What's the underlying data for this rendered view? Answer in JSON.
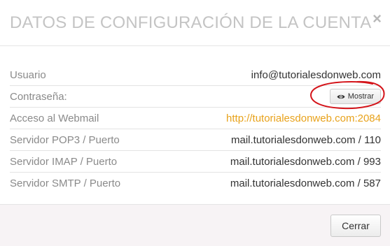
{
  "modal": {
    "title": "DATOS DE CONFIGURACIÓN DE LA CUENTA",
    "close_symbol": "×",
    "close_button_label": "Cerrar"
  },
  "rows": [
    {
      "label": "Usuario",
      "value": "info@tutorialesdonweb.com"
    },
    {
      "label": "Contraseña:",
      "button_label": "Mostrar",
      "button_icon": "eye-icon"
    },
    {
      "label": "Acceso al Webmail",
      "value": "http://tutorialesdonweb.com:2084"
    },
    {
      "label": "Servidor POP3 / Puerto",
      "value": "mail.tutorialesdonweb.com / 110"
    },
    {
      "label": "Servidor IMAP / Puerto",
      "value": "mail.tutorialesdonweb.com / 993"
    },
    {
      "label": "Servidor SMTP / Puerto",
      "value": "mail.tutorialesdonweb.com / 587"
    }
  ],
  "colors": {
    "link": "#e8a21b",
    "annotation": "#d4141a",
    "title": "#c4c4c4"
  }
}
